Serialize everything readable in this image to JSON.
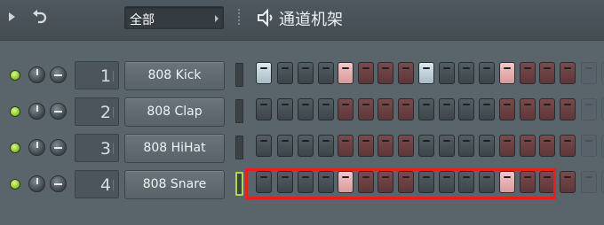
{
  "header": {
    "category": "全部",
    "title": "通道机架"
  },
  "channels": [
    {
      "number": "1",
      "name": "808 Kick",
      "active": false,
      "steps": [
        "lb",
        "d",
        "d",
        "d",
        "p",
        "r",
        "r",
        "r",
        "lb",
        "d",
        "d",
        "d",
        "p",
        "r",
        "r",
        "r",
        "f",
        "f"
      ]
    },
    {
      "number": "2",
      "name": "808 Clap",
      "active": false,
      "steps": [
        "d",
        "d",
        "d",
        "d",
        "r",
        "r",
        "r",
        "r",
        "d",
        "d",
        "d",
        "d",
        "r",
        "r",
        "r",
        "r",
        "f",
        "f"
      ]
    },
    {
      "number": "3",
      "name": "808 HiHat",
      "active": false,
      "steps": [
        "d",
        "d",
        "d",
        "d",
        "r",
        "r",
        "r",
        "r",
        "d",
        "d",
        "d",
        "d",
        "r",
        "r",
        "r",
        "r",
        "f",
        "f"
      ]
    },
    {
      "number": "4",
      "name": "808 Snare",
      "active": true,
      "steps": [
        "d",
        "d",
        "d",
        "d",
        "p",
        "r",
        "r",
        "r",
        "d",
        "d",
        "d",
        "d",
        "p",
        "r",
        "r",
        "r",
        "f",
        "f"
      ]
    }
  ],
  "colors": {
    "highlight": "#e8201a",
    "led": "#8fcf2b"
  }
}
